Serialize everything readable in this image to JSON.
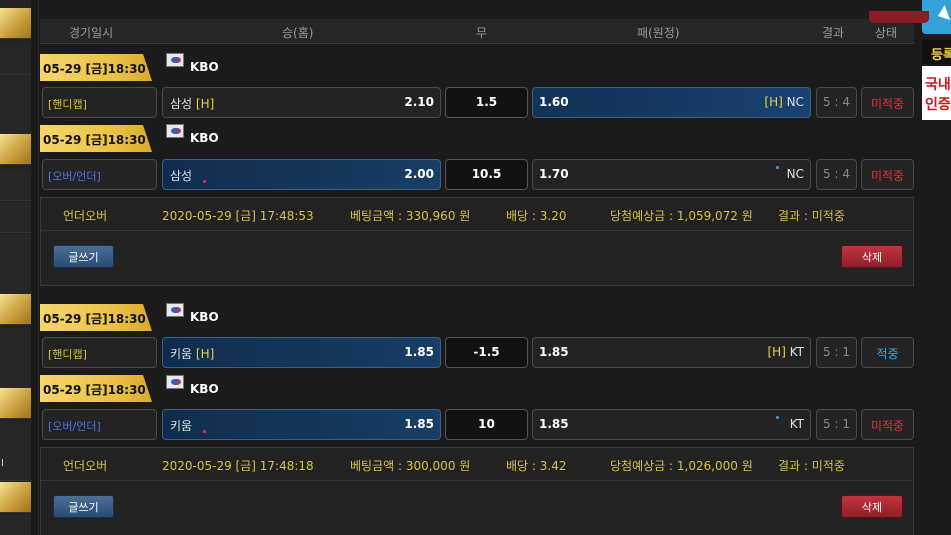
{
  "header": {
    "col_time": "경기일시",
    "col_home": "승(홈)",
    "col_draw": "무",
    "col_away": "패(원정)",
    "col_result": "결과",
    "col_status": "상태"
  },
  "rightbar": {
    "banner1": "등록",
    "banner2_line1": "국내",
    "banner2_line2": "인증"
  },
  "leftbar": {
    "label": "I"
  },
  "groups": [
    {
      "games": [
        {
          "date": "05-29 [금]18:30",
          "league": "KBO",
          "type": "[핸디캡]",
          "home": "삼성",
          "home_tag": "[H]",
          "home_odds": "2.10",
          "line": "1.5",
          "away_odds": "1.60",
          "away_tag": "[H]",
          "away": "NC",
          "score": "5 : 4",
          "status": "미적중"
        },
        {
          "date": "05-29 [금]18:30",
          "league": "KBO",
          "type": "[오버/언더]",
          "home": "삼성",
          "home_odds": "2.00",
          "line": "10.5",
          "away_odds": "1.70",
          "away": "NC",
          "score": "5 : 4",
          "status": "미적중"
        }
      ],
      "bet": {
        "kind": "언더오버",
        "time": "2020-05-29 [금] 17:48:53",
        "amount": "베팅금액 : 330,960 원",
        "odds": "배당 : 3.20",
        "expected": "당첨예상금 : 1,059,072 원",
        "result": "결과 : 미적중",
        "write_label": "글쓰기",
        "delete_label": "삭제"
      }
    },
    {
      "games": [
        {
          "date": "05-29 [금]18:30",
          "league": "KBO",
          "type": "[핸디캡]",
          "home": "키움",
          "home_tag": "[H]",
          "home_odds": "1.85",
          "line": "-1.5",
          "away_odds": "1.85",
          "away_tag": "[H]",
          "away": "KT",
          "score": "5 : 1",
          "status": "적중"
        },
        {
          "date": "05-29 [금]18:30",
          "league": "KBO",
          "type": "[오버/언더]",
          "home": "키움",
          "home_odds": "1.85",
          "line": "10",
          "away_odds": "1.85",
          "away": "KT",
          "score": "5 : 1",
          "status": "미적중"
        }
      ],
      "bet": {
        "kind": "언더오버",
        "time": "2020-05-29 [금] 17:48:18",
        "amount": "베팅금액 : 300,000 원",
        "odds": "배당 : 3.42",
        "expected": "당첨예상금 : 1,026,000 원",
        "result": "결과 : 미적중",
        "write_label": "글쓰기",
        "delete_label": "삭제"
      }
    }
  ]
}
